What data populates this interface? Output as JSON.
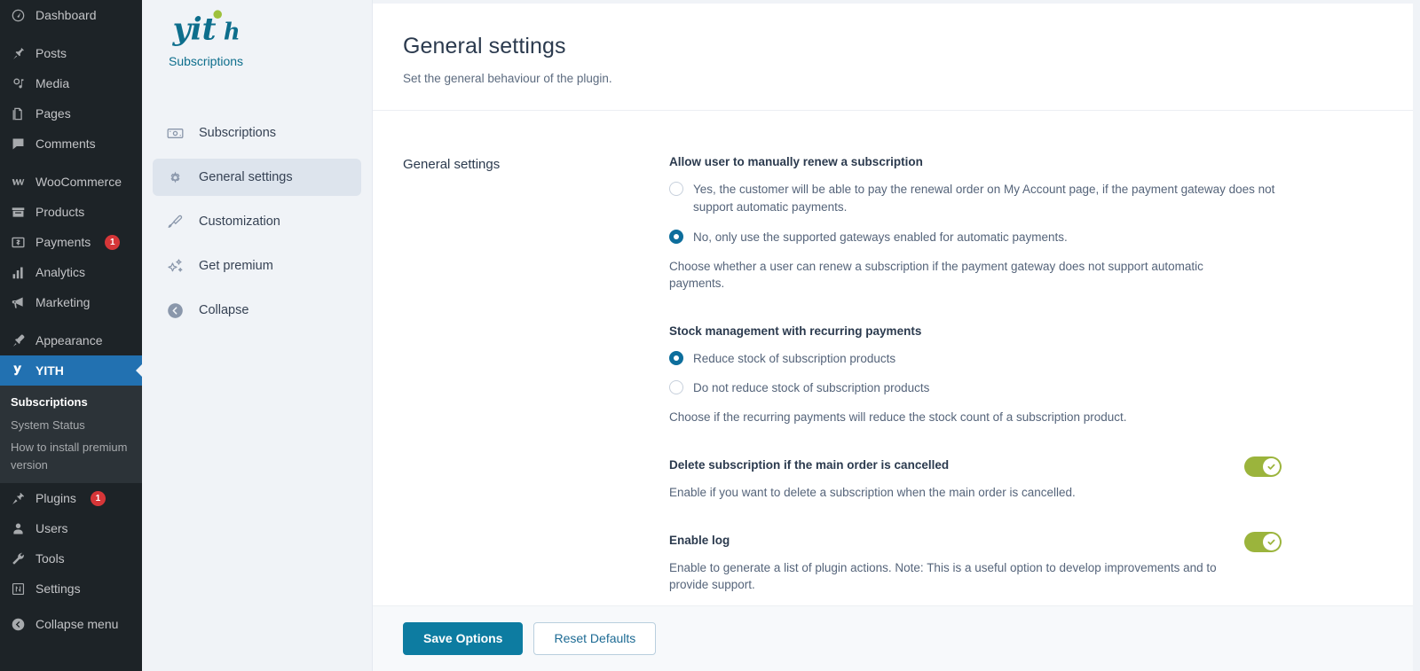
{
  "wp_sidebar": {
    "items": [
      {
        "label": "Dashboard",
        "icon": "dashboard-icon",
        "badge": null
      },
      {
        "label": "Posts",
        "icon": "pin-icon",
        "badge": null
      },
      {
        "label": "Media",
        "icon": "media-icon",
        "badge": null
      },
      {
        "label": "Pages",
        "icon": "pages-icon",
        "badge": null
      },
      {
        "label": "Comments",
        "icon": "comments-icon",
        "badge": null
      },
      {
        "label": "WooCommerce",
        "icon": "woocommerce-icon",
        "badge": null
      },
      {
        "label": "Products",
        "icon": "products-icon",
        "badge": null
      },
      {
        "label": "Payments",
        "icon": "payments-icon",
        "badge": "1"
      },
      {
        "label": "Analytics",
        "icon": "analytics-icon",
        "badge": null
      },
      {
        "label": "Marketing",
        "icon": "marketing-icon",
        "badge": null
      },
      {
        "label": "Appearance",
        "icon": "appearance-icon",
        "badge": null
      },
      {
        "label": "YITH",
        "icon": "yith-icon",
        "badge": null
      },
      {
        "label": "Plugins",
        "icon": "plugins-icon",
        "badge": "1"
      },
      {
        "label": "Users",
        "icon": "users-icon",
        "badge": null
      },
      {
        "label": "Tools",
        "icon": "tools-icon",
        "badge": null
      },
      {
        "label": "Settings",
        "icon": "settings-icon",
        "badge": null
      }
    ],
    "yith_submenu": [
      {
        "label": "Subscriptions",
        "current": true
      },
      {
        "label": "System Status",
        "current": false
      },
      {
        "label": "How to install premium version",
        "current": false
      }
    ],
    "collapse_label": "Collapse menu"
  },
  "yith_panel": {
    "logo_text": "yith",
    "plugin_name": "Subscriptions",
    "nav": [
      {
        "label": "Subscriptions",
        "icon": "banknote-icon",
        "active": false
      },
      {
        "label": "General settings",
        "icon": "gear-icon",
        "active": true
      },
      {
        "label": "Customization",
        "icon": "paintbrush-icon",
        "active": false
      },
      {
        "label": "Get premium",
        "icon": "sparkles-icon",
        "active": false
      },
      {
        "label": "Collapse",
        "icon": "collapse-arrow-icon",
        "active": false
      }
    ]
  },
  "page": {
    "title": "General settings",
    "subtitle": "Set the general behaviour of the plugin.",
    "section_label": "General settings"
  },
  "fields": {
    "manual_renew": {
      "title": "Allow user to manually renew a subscription",
      "options": [
        {
          "label": "Yes, the customer will be able to pay the renewal order on My Account page, if the payment gateway does not support automatic payments.",
          "checked": false
        },
        {
          "label": "No, only use the supported gateways enabled for automatic payments.",
          "checked": true
        }
      ],
      "description": "Choose whether a user can renew a subscription if the payment gateway does not support automatic payments."
    },
    "stock_management": {
      "title": "Stock management with recurring payments",
      "options": [
        {
          "label": "Reduce stock of subscription products",
          "checked": true
        },
        {
          "label": "Do not reduce stock of subscription products",
          "checked": false
        }
      ],
      "description": "Choose if the recurring payments will reduce the stock count of a subscription product."
    },
    "delete_subscription": {
      "title": "Delete subscription if the main order is cancelled",
      "description": "Enable if you want to delete a subscription when the main order is cancelled.",
      "enabled": true
    },
    "enable_log": {
      "title": "Enable log",
      "description": "Enable to generate a list of plugin actions. Note: This is a useful option to develop improvements and to provide support.",
      "enabled": true
    }
  },
  "footer": {
    "save_label": "Save Options",
    "reset_label": "Reset Defaults"
  },
  "colors": {
    "wp_sidebar_bg": "#1d2327",
    "wp_active": "#2271b1",
    "yith_teal": "#0d6e8c",
    "toggle_green": "#9bb43c",
    "primary_button": "#0d7ca1",
    "badge_red": "#d63638"
  }
}
